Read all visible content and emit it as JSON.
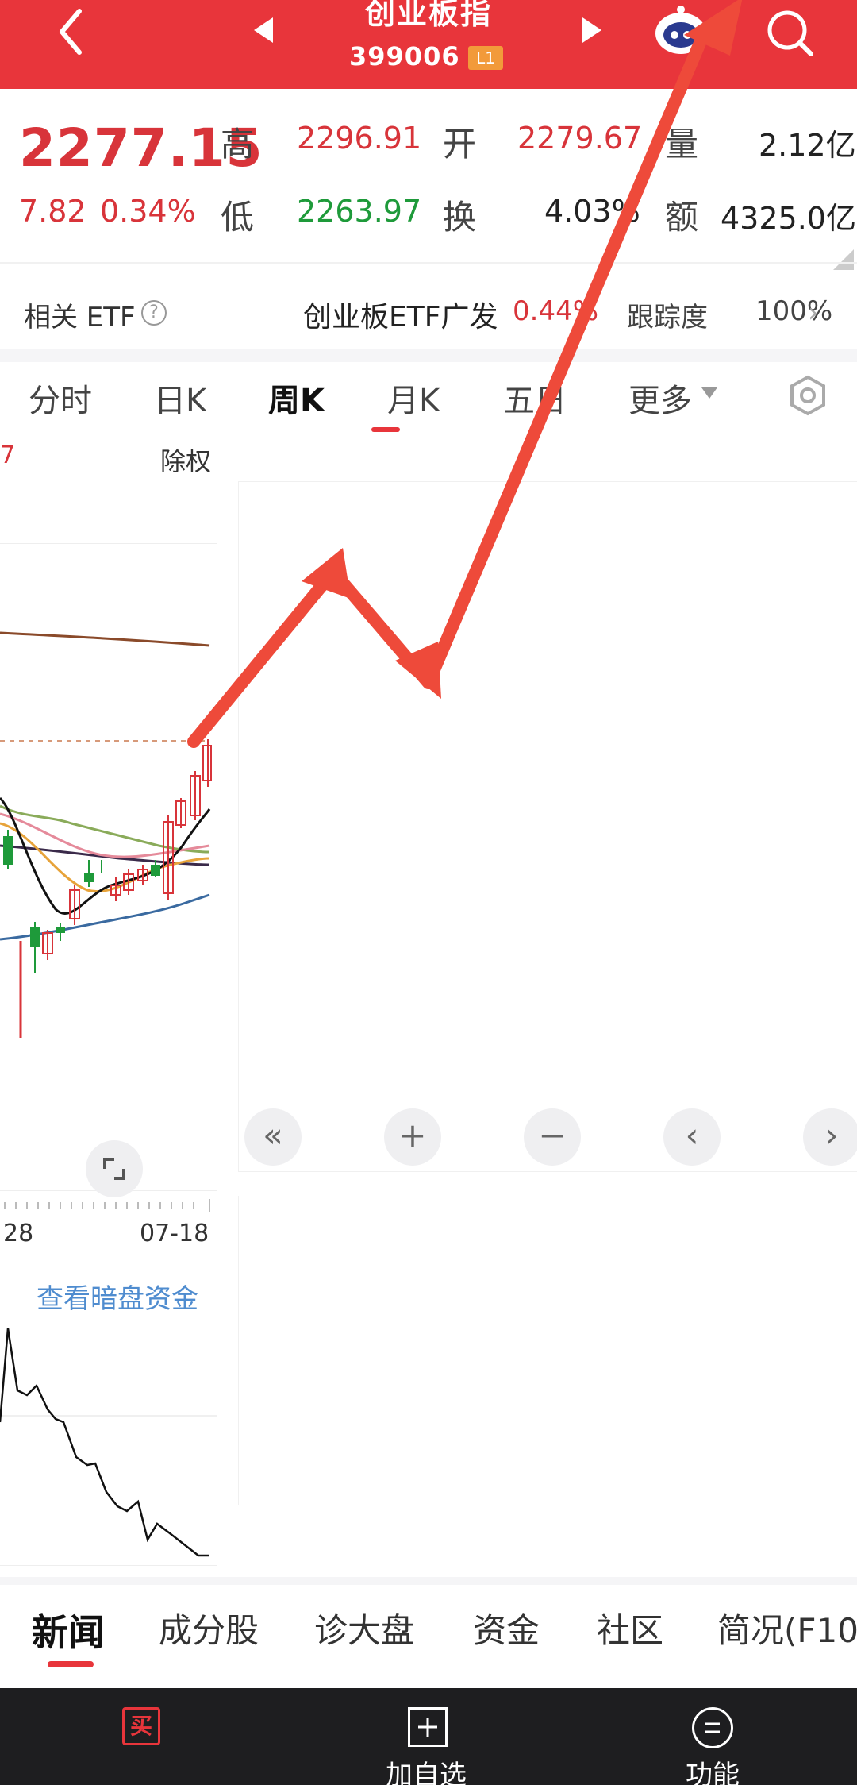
{
  "header": {
    "title": "创业板指",
    "code": "399006",
    "level_badge": "L1",
    "bg_color": "#e8353b"
  },
  "quote": {
    "price": "2277.15",
    "change": "7.82",
    "change_pct": "0.34%",
    "high_label": "高",
    "high": "2296.91",
    "low_label": "低",
    "low": "2263.97",
    "open_label": "开",
    "open": "2279.67",
    "turnover_label": "换",
    "turnover": "4.03%",
    "volume_label": "量",
    "volume": "2.12亿",
    "amount_label": "额",
    "amount": "4325.0亿"
  },
  "etf": {
    "label": "相关 ETF",
    "help_icon": "?",
    "name": "创业板ETF广发",
    "change": "0.44%",
    "track_label": "跟踪度",
    "track_value": "100%",
    "arrow": "›"
  },
  "chart_tabs": [
    {
      "label": "分时"
    },
    {
      "label": "日K"
    },
    {
      "label": "周K"
    },
    {
      "label": "月K"
    },
    {
      "label": "五日"
    },
    {
      "label": "更多"
    }
  ],
  "active_chart_tab": "周K",
  "chart": {
    "adjust_label": "除权",
    "cut_label": "7",
    "date_left": "28",
    "date_right": "07-18",
    "dark_pool_link": "查看暗盘资金"
  },
  "nav_buttons": [
    "«",
    "+",
    "−",
    "‹",
    "›"
  ],
  "bottom_tabs": [
    {
      "label": "新闻"
    },
    {
      "label": "成分股"
    },
    {
      "label": "诊大盘"
    },
    {
      "label": "资金"
    },
    {
      "label": "社区"
    },
    {
      "label": "简况(F10"
    }
  ],
  "bottom_bar": {
    "buy_icon": "买",
    "add_label": "加自选",
    "func_label": "功能"
  },
  "colors": {
    "up": "#d8343a",
    "down": "#1e9a3a",
    "arrow": "#ee4a3a"
  }
}
